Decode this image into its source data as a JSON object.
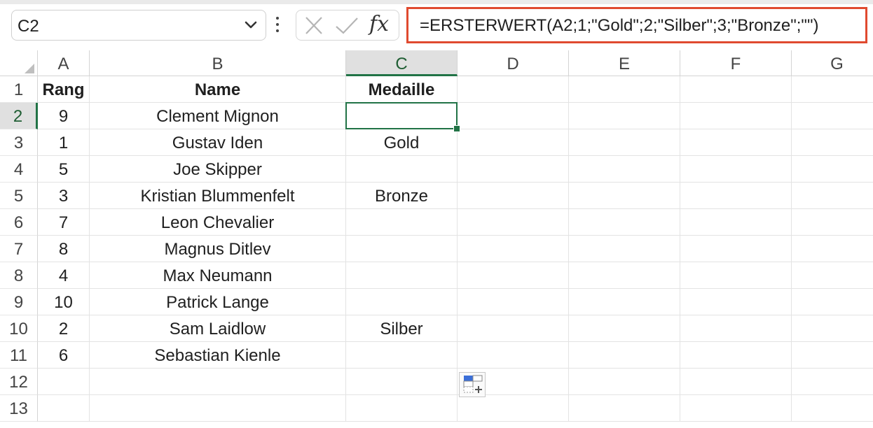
{
  "formula_bar": {
    "name_box": "C2",
    "fx_label": "fx",
    "formula": "=ERSTERWERT(A2;1;\"Gold\";2;\"Silber\";3;\"Bronze\";\"\")",
    "accent_color": "#e04a2f"
  },
  "sheet": {
    "columns": [
      "A",
      "B",
      "C",
      "D",
      "E",
      "F",
      "G"
    ],
    "rows": [
      "1",
      "2",
      "3",
      "4",
      "5",
      "6",
      "7",
      "8",
      "9",
      "10",
      "11",
      "12",
      "13"
    ],
    "selected_cell": "C2",
    "selection_color": "#217346",
    "header": [
      "Rang",
      "Name",
      "Medaille"
    ],
    "data": [
      [
        "9",
        "Clement Mignon",
        ""
      ],
      [
        "1",
        "Gustav Iden",
        "Gold"
      ],
      [
        "5",
        "Joe Skipper",
        ""
      ],
      [
        "3",
        "Kristian Blummenfelt",
        "Bronze"
      ],
      [
        "7",
        "Leon Chevalier",
        ""
      ],
      [
        "8",
        "Magnus Ditlev",
        ""
      ],
      [
        "4",
        "Max Neumann",
        ""
      ],
      [
        "10",
        "Patrick Lange",
        ""
      ],
      [
        "2",
        "Sam Laidlow",
        "Silber"
      ],
      [
        "6",
        "Sebastian Kienle",
        ""
      ]
    ]
  },
  "icons": {
    "name_box_dropdown": "chevron-down-icon",
    "more": "vertical-dots-icon",
    "cancel": "cancel-x-icon",
    "enter": "check-icon",
    "quick_analysis": "quick-analysis-icon"
  }
}
